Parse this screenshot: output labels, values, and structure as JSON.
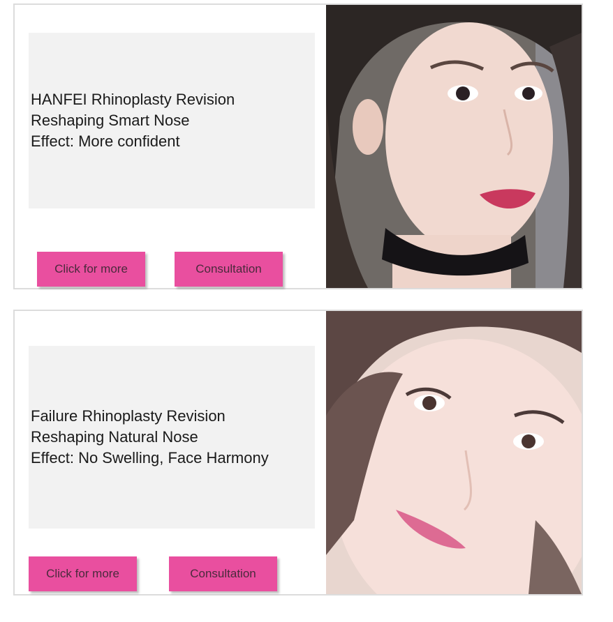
{
  "cards": [
    {
      "lines": [
        "HANFEI Rhinoplasty Revision",
        "Reshaping Smart Nose",
        "Effect: More confident"
      ],
      "more_label": "Click for more",
      "consult_label": "Consultation"
    },
    {
      "lines": [
        "Failure Rhinoplasty Revision",
        "Reshaping Natural Nose",
        "Effect: No Swelling, Face Harmony"
      ],
      "more_label": "Click for more",
      "consult_label": "Consultation"
    }
  ],
  "colors": {
    "button": "#e94f9f",
    "textbox": "#f2f2f2",
    "border": "#dcdcdc"
  }
}
